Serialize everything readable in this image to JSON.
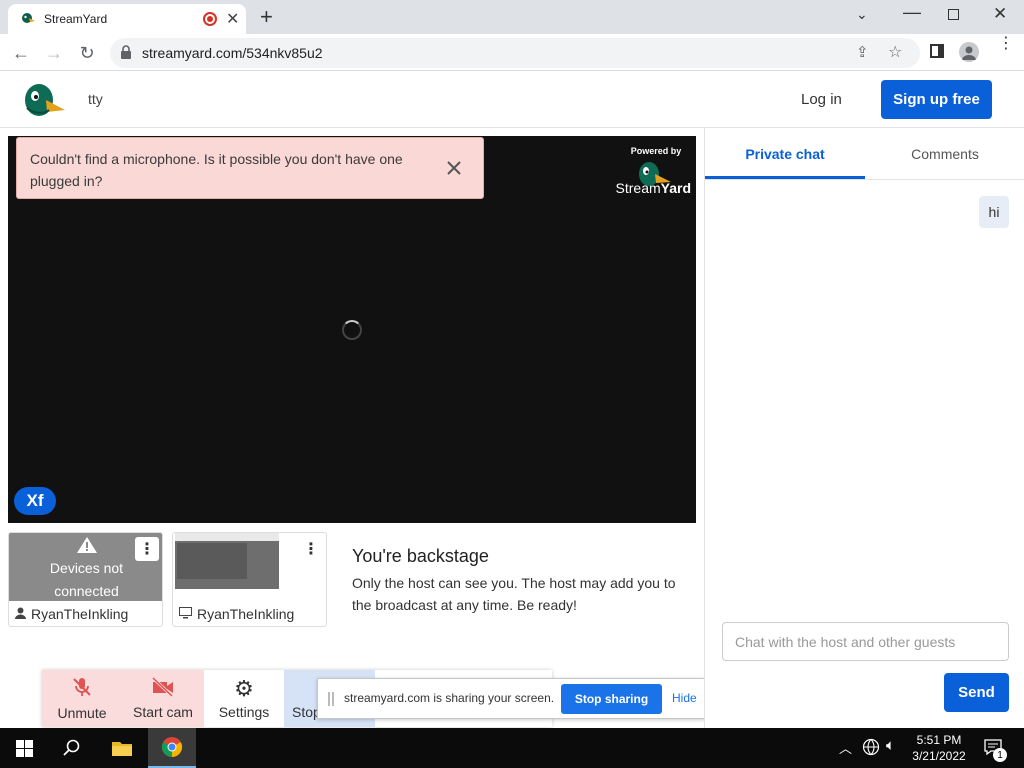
{
  "browser": {
    "tab_title": "StreamYard",
    "url": "streamyard.com/534nkv85u2"
  },
  "header": {
    "room_name": "tty",
    "login_label": "Log in",
    "signup_label": "Sign up free"
  },
  "stage": {
    "alert_message": "Couldn't find a microphone. Is it possible you don't have one plugged in?",
    "powered_by": "Powered by",
    "brand_stream": "Stream",
    "brand_yard": "Yard",
    "badge": "Xf"
  },
  "guests": [
    {
      "status": "Devices not connected",
      "name": "RyanTheInkling"
    },
    {
      "name": "RyanTheInkling"
    }
  ],
  "backstage": {
    "title": "You're backstage",
    "text": "Only the host can see you. The host may add you to the broadcast at any time. Be ready!"
  },
  "controls": {
    "unmute": "Unmute",
    "start_cam": "Start cam",
    "settings": "Settings",
    "stop": "Stop"
  },
  "share_bar": {
    "message": "streamyard.com is sharing your screen.",
    "stop_label": "Stop sharing",
    "hide_label": "Hide"
  },
  "chat": {
    "tabs": [
      "Private chat",
      "Comments"
    ],
    "active_tab": "Private chat",
    "messages": [
      "hi"
    ],
    "input_placeholder": "Chat with the host and other guests",
    "send_label": "Send"
  },
  "taskbar": {
    "time": "5:51 PM",
    "date": "3/21/2022",
    "notification_count": "1"
  },
  "colors": {
    "accent": "#0a60d8",
    "alert_bg": "#f9d8d6",
    "muted_red": "#e05353"
  }
}
